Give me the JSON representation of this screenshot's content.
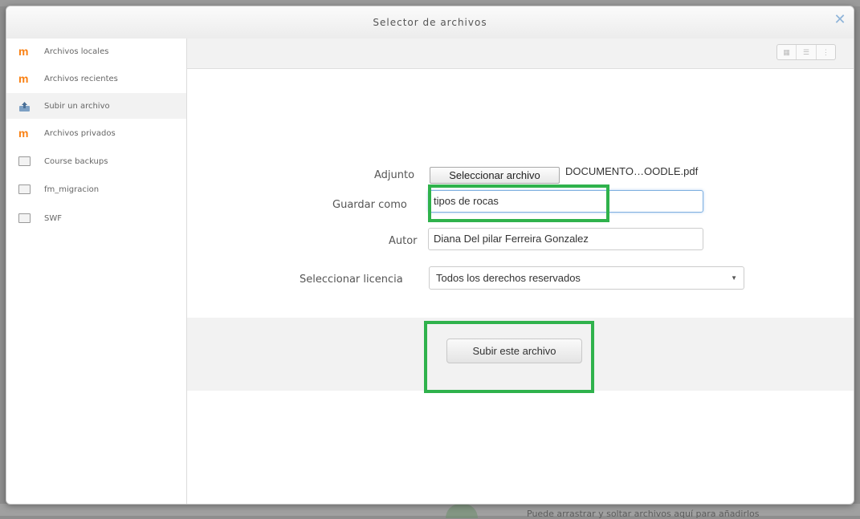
{
  "background": {
    "bottom_text": "Puede arrastrar y soltar archivos aquí para añadirlos"
  },
  "dialog": {
    "title": "Selector de archivos",
    "close_icon": "close-icon"
  },
  "sidebar": {
    "items": [
      {
        "label": "Archivos locales",
        "icon": "moodle-icon"
      },
      {
        "label": "Archivos recientes",
        "icon": "moodle-icon"
      },
      {
        "label": "Subir un archivo",
        "icon": "upload-icon"
      },
      {
        "label": "Archivos privados",
        "icon": "moodle-icon"
      },
      {
        "label": "Course backups",
        "icon": "box-icon"
      },
      {
        "label": "fm_migracion",
        "icon": "box-icon"
      },
      {
        "label": "SWF",
        "icon": "box-icon"
      }
    ],
    "active_index": 2
  },
  "toolbar": {
    "view_icons": [
      "icons-view-icon",
      "list-view-icon",
      "tree-view-icon"
    ]
  },
  "form": {
    "attachment_label": "Adjunto",
    "choose_file_button": "Seleccionar archivo",
    "file_name": "DOCUMENTO…OODLE.pdf",
    "save_as_label": "Guardar como",
    "save_as_value": "tipos de rocas",
    "author_label": "Autor",
    "author_value": "Diana Del pilar Ferreira Gonzalez",
    "license_label": "Seleccionar licencia",
    "license_value": "Todos los derechos reservados"
  },
  "actions": {
    "upload_button": "Subir este archivo"
  },
  "colors": {
    "highlight": "#2fb24c",
    "moodle": "#f98012"
  }
}
